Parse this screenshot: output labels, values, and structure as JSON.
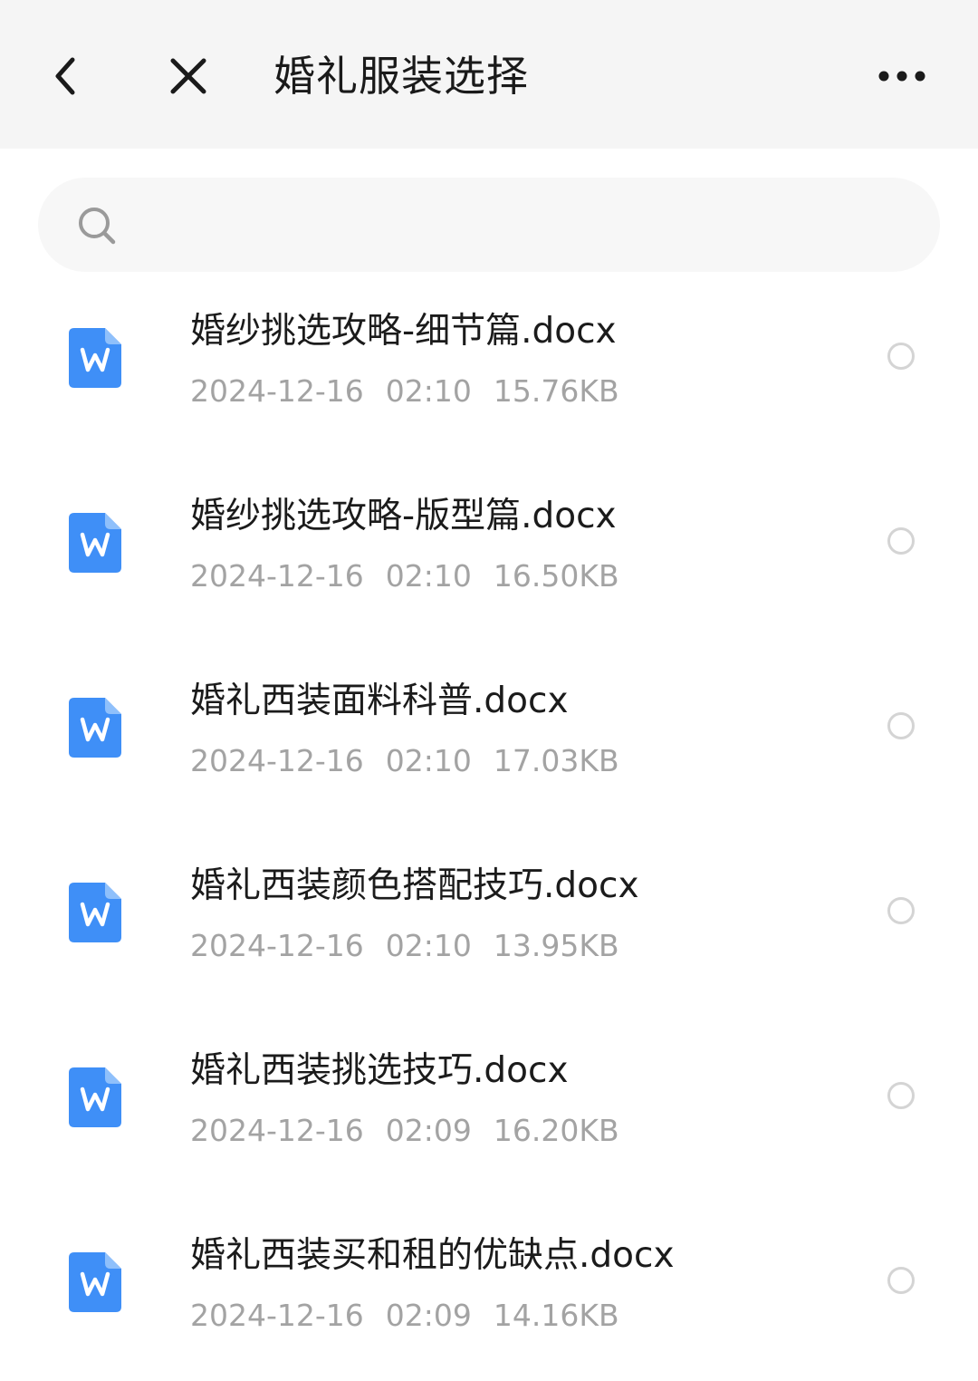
{
  "header": {
    "title": "婚礼服装选择",
    "back_icon": "chevron-left-icon",
    "close_icon": "close-icon",
    "more_icon": "more-horizontal-icon"
  },
  "search": {
    "value": "",
    "placeholder": "",
    "icon": "search-icon"
  },
  "colors": {
    "header_bg": "#f5f5f5",
    "search_bg": "#f7f7f7",
    "doc_icon_blue": "#3f8ff7",
    "meta_text": "#a3a3a3",
    "title_text": "#1a1a1a"
  },
  "files": [
    {
      "name": "婚纱挑选攻略-细节篇.docx",
      "date": "2024-12-16",
      "time": "02:10",
      "size": "15.76KB",
      "icon": "word-document-icon",
      "selected": false
    },
    {
      "name": "婚纱挑选攻略-版型篇.docx",
      "date": "2024-12-16",
      "time": "02:10",
      "size": "16.50KB",
      "icon": "word-document-icon",
      "selected": false
    },
    {
      "name": "婚礼西装面料科普.docx",
      "date": "2024-12-16",
      "time": "02:10",
      "size": "17.03KB",
      "icon": "word-document-icon",
      "selected": false
    },
    {
      "name": "婚礼西装颜色搭配技巧.docx",
      "date": "2024-12-16",
      "time": "02:10",
      "size": "13.95KB",
      "icon": "word-document-icon",
      "selected": false
    },
    {
      "name": "婚礼西装挑选技巧.docx",
      "date": "2024-12-16",
      "time": "02:09",
      "size": "16.20KB",
      "icon": "word-document-icon",
      "selected": false
    },
    {
      "name": "婚礼西装买和租的优缺点.docx",
      "date": "2024-12-16",
      "time": "02:09",
      "size": "14.16KB",
      "icon": "word-document-icon",
      "selected": false
    }
  ]
}
